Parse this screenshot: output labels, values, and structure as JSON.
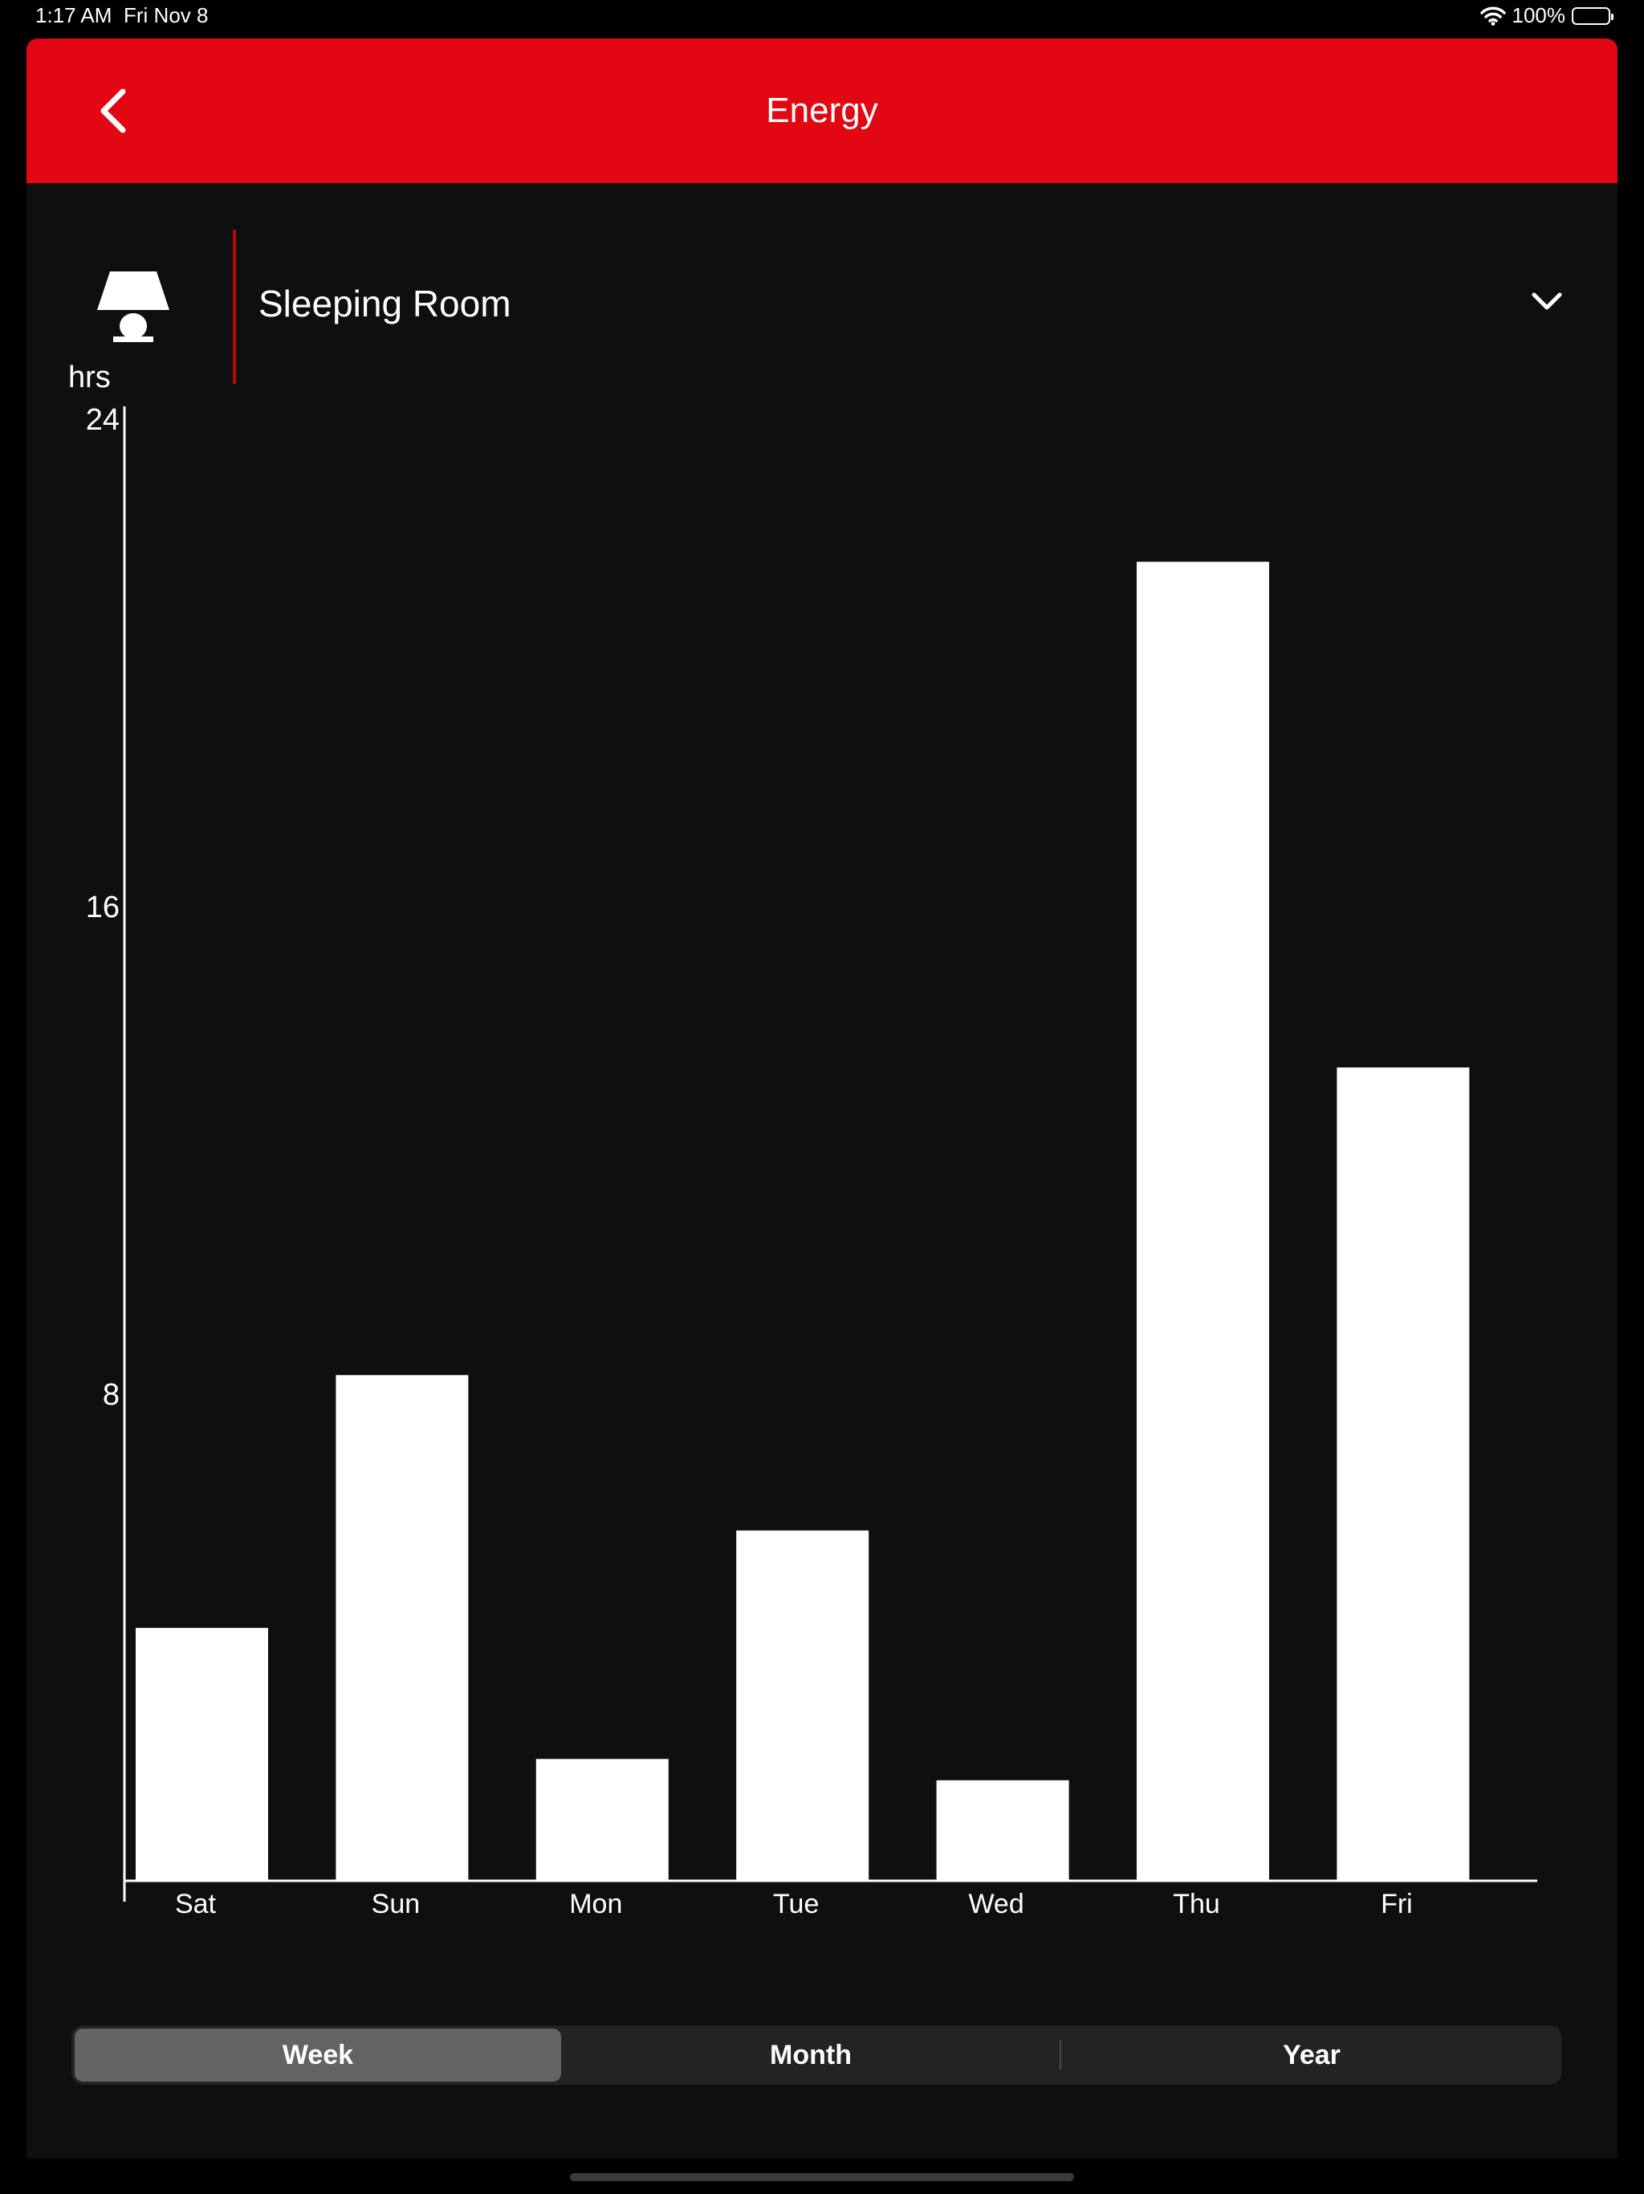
{
  "status_bar": {
    "time": "1:17 AM",
    "date": "Fri Nov 8",
    "battery": "100%"
  },
  "header": {
    "title": "Energy",
    "back_icon": "chevron-left-icon",
    "background": "#e30613"
  },
  "device": {
    "name": "Sleeping Room",
    "icon": "lamp-icon",
    "dropdown_icon": "chevron-down-icon"
  },
  "chart_data": {
    "type": "bar",
    "ylabel": "hrs",
    "categories": [
      "Sat",
      "Sun",
      "Mon",
      "Tue",
      "Wed",
      "Thu",
      "Fri"
    ],
    "values": [
      4.15,
      8.3,
      2.0,
      5.75,
      1.65,
      21.65,
      13.35
    ],
    "yticks": [
      8,
      16,
      24
    ],
    "ylim": [
      0,
      24.2
    ],
    "grid": false,
    "bar_color": "#ffffff"
  },
  "segments": {
    "week": "Week",
    "month": "Month",
    "year": "Year",
    "selected": "Week"
  }
}
